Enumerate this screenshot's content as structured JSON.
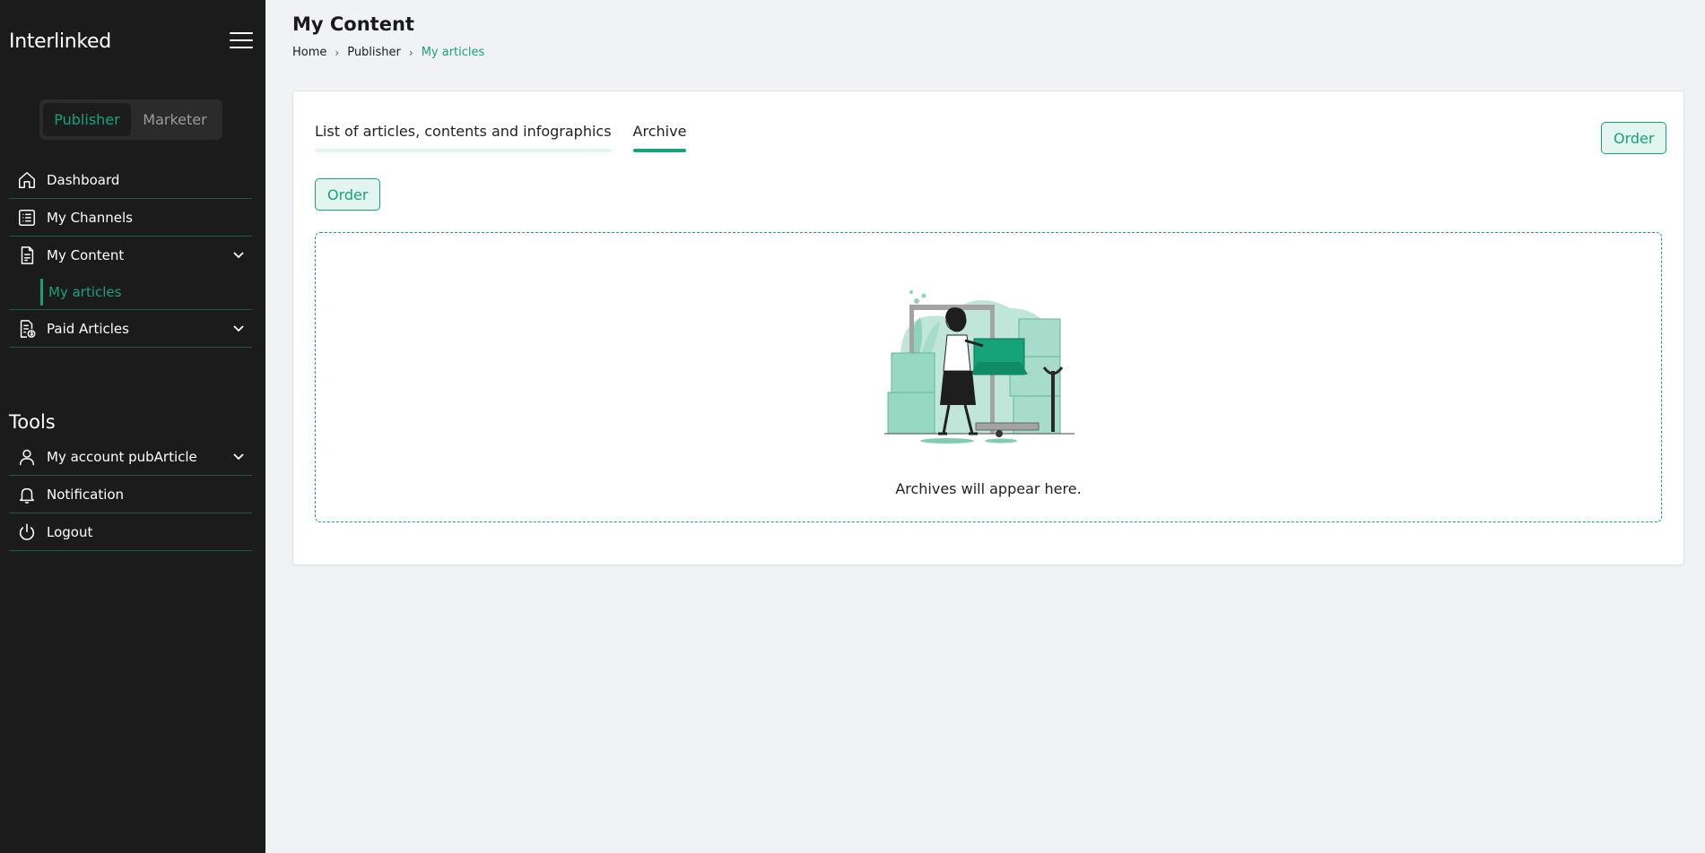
{
  "sidebar": {
    "brand": "Interlinked",
    "roles": {
      "publisher": "Publisher",
      "marketer": "Marketer"
    },
    "nav": {
      "dashboard": "Dashboard",
      "channels": "My Channels",
      "content": "My Content",
      "content_sub": "My articles",
      "paid": "Paid Articles"
    },
    "tools_title": "Tools",
    "tools": {
      "account": "My account pubArticle",
      "notification": "Notification",
      "logout": "Logout"
    }
  },
  "header": {
    "title": "My Content",
    "breadcrumb": [
      "Home",
      "Publisher",
      "My articles"
    ]
  },
  "main": {
    "tabs": [
      "List of articles, contents and infographics",
      "Archive"
    ],
    "active_tab": "Archive",
    "order_label": "Order",
    "empty_text": "Archives will appear here."
  },
  "colors": {
    "accent": "#16a37a",
    "sidebar_bg": "#1b1b1b",
    "page_bg": "#f1f2f6"
  }
}
